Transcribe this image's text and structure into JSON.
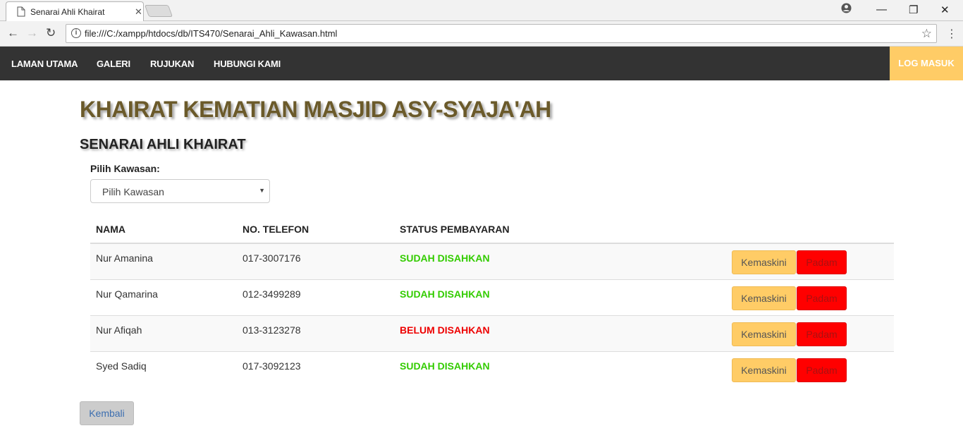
{
  "browser": {
    "tab_title": "Senarai Ahli Khairat",
    "url": "file:///C:/xampp/htdocs/db/ITS470/Senarai_Ahli_Kawasan.html"
  },
  "nav": {
    "items": [
      "LAMAN UTAMA",
      "GALERI",
      "RUJUKAN",
      "HUBUNGI KAMI"
    ],
    "login": "LOG MASUK"
  },
  "page": {
    "title": "KHAIRAT KEMATIAN MASJID ASY-SYAJA'AH",
    "subtitle": "SENARAI AHLI KHAIRAT",
    "filter_label": "Pilih Kawasan:",
    "filter_selected": "Pilih Kawasan",
    "back_label": "Kembali"
  },
  "table": {
    "headers": [
      "NAMA",
      "NO. TELEFON",
      "STATUS PEMBAYARAN"
    ],
    "edit_label": "Kemaskini",
    "delete_label": "Padam",
    "rows": [
      {
        "name": "Nur Amanina",
        "phone": "017-3007176",
        "status": "SUDAH DISAHKAN",
        "status_color": "#33cc00"
      },
      {
        "name": "Nur Qamarina",
        "phone": "012-3499289",
        "status": "SUDAH DISAHKAN",
        "status_color": "#33cc00"
      },
      {
        "name": "Nur Afiqah",
        "phone": "013-3123278",
        "status": "BELUM DISAHKAN",
        "status_color": "#ee0000"
      },
      {
        "name": "Syed Sadiq",
        "phone": "017-3092123",
        "status": "SUDAH DISAHKAN",
        "status_color": "#33cc00"
      }
    ]
  },
  "colors": {
    "nav_bg": "#333333",
    "accent": "#ffcc66",
    "title": "#6b5a2a",
    "danger": "#ff0000"
  }
}
